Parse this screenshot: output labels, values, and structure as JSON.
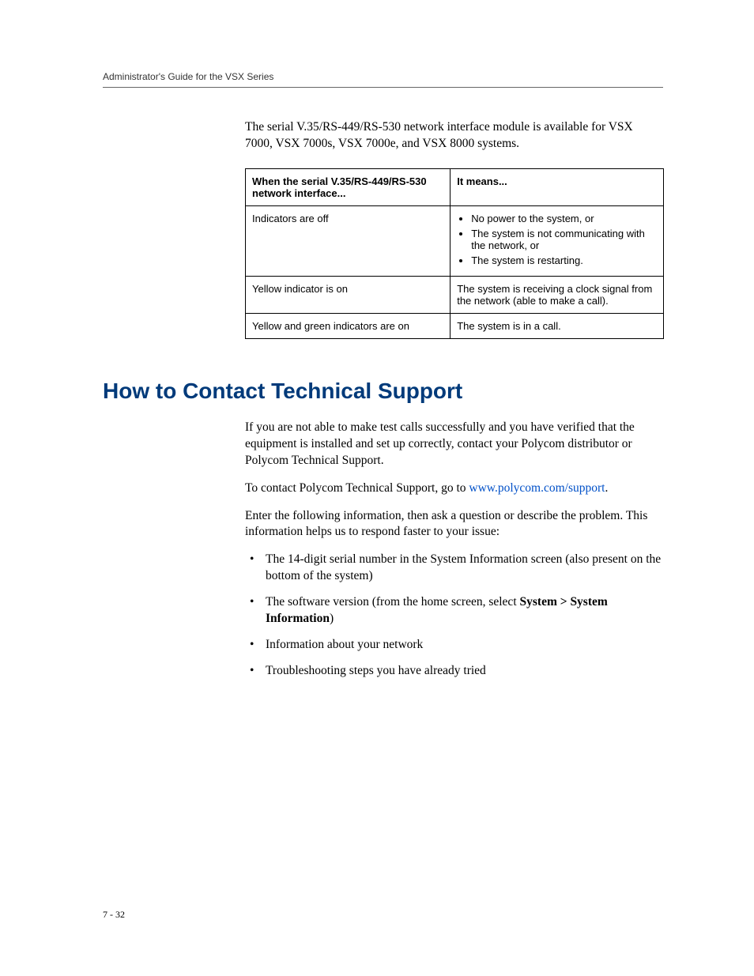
{
  "header": {
    "running_title": "Administrator's Guide for the VSX Series"
  },
  "intro": {
    "para": "The serial V.35/RS-449/RS-530 network interface module is available for VSX 7000, VSX 7000s, VSX 7000e, and VSX 8000 systems."
  },
  "table": {
    "head_left": "When the serial V.35/RS-449/RS-530 network interface...",
    "head_right": "It means...",
    "rows": [
      {
        "left": "Indicators are off",
        "right_list": [
          "No power to the system, or",
          "The system is not communicating with the network, or",
          "The system is restarting."
        ]
      },
      {
        "left": "Yellow indicator is on",
        "right_text": "The system is receiving a clock signal from the network (able to make a call)."
      },
      {
        "left": "Yellow and green indicators are on",
        "right_text": "The system is in a call."
      }
    ]
  },
  "section": {
    "title": "How to Contact Technical Support",
    "p1": "If you are not able to make test calls successfully and you have verified that the equipment is installed and set up correctly, contact your Polycom distributor or Polycom Technical Support.",
    "p2_pre": "To contact Polycom Technical Support, go to ",
    "p2_link": "www.polycom.com/support",
    "p2_post": ".",
    "p3": "Enter the following information, then ask a question or describe the problem. This information helps us to respond faster to your issue:",
    "bullets": [
      {
        "text_pre": "The 14-digit serial number in the System Information screen (also present on the bottom of the system)"
      },
      {
        "text_pre": "The software version (from the home screen, select ",
        "bold": "System > System Information",
        "text_post": ")"
      },
      {
        "text_pre": "Information about your network"
      },
      {
        "text_pre": "Troubleshooting steps you have already tried"
      }
    ]
  },
  "footer": {
    "page_num": "7 - 32"
  }
}
